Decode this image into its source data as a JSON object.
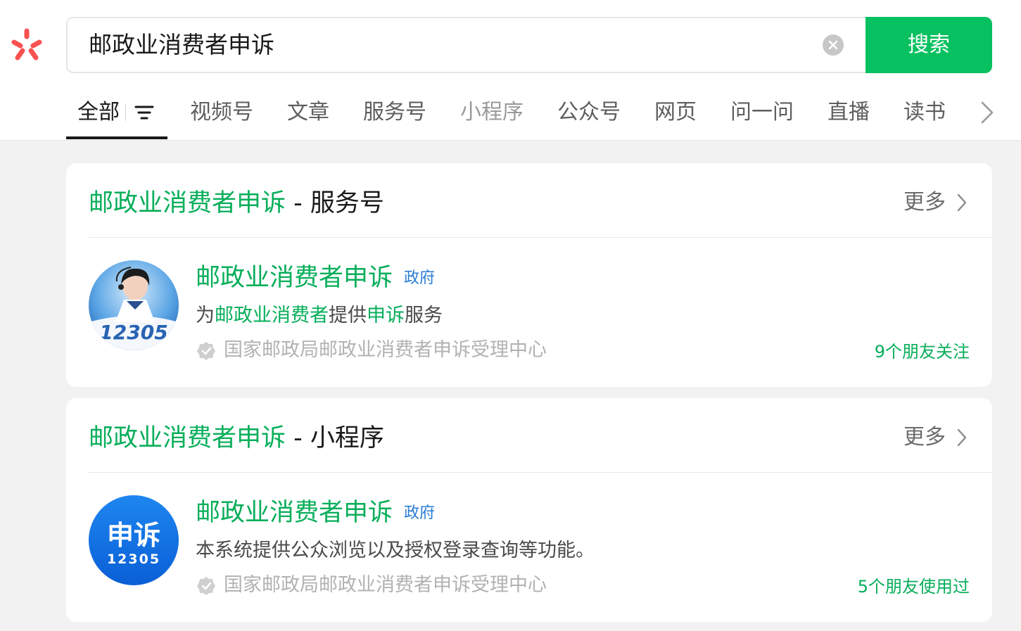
{
  "colors": {
    "accent": "#07c160",
    "accent_text": "#07ae5a",
    "logo_red": "#fa5151",
    "tag_blue": "#2a7cd6"
  },
  "logo_icon": "wechat-search-logo-icon",
  "search": {
    "query": "邮政业消费者申诉",
    "button_label": "搜索"
  },
  "tabs": [
    {
      "label": "全部"
    },
    {
      "label": "视频号"
    },
    {
      "label": "文章"
    },
    {
      "label": "服务号"
    },
    {
      "label": "小程序"
    },
    {
      "label": "公众号"
    },
    {
      "label": "网页"
    },
    {
      "label": "问一问"
    },
    {
      "label": "直播"
    },
    {
      "label": "读书"
    }
  ],
  "active_tab": "全部",
  "sections": [
    {
      "title_keyword": "邮政业消费者申诉",
      "title_suffix": " - 服务号",
      "more_label": "更多",
      "item": {
        "name": "邮政业消费者申诉",
        "tag": "政府",
        "desc_parts": [
          "为",
          "邮政业消费者",
          "提供",
          "申诉",
          "服务"
        ],
        "org": "国家邮政局邮政业消费者申诉受理中心",
        "friends": "9个朋友关注",
        "avatar_text": "12305"
      }
    },
    {
      "title_keyword": "邮政业消费者申诉",
      "title_suffix": " - 小程序",
      "more_label": "更多",
      "item": {
        "name": "邮政业消费者申诉",
        "tag": "政府",
        "desc": "本系统提供公众浏览以及授权登录查询等功能。",
        "org": "国家邮政局邮政业消费者申诉受理中心",
        "friends": "5个朋友使用过",
        "avatar_title": "申诉",
        "avatar_number": "12305"
      }
    }
  ]
}
